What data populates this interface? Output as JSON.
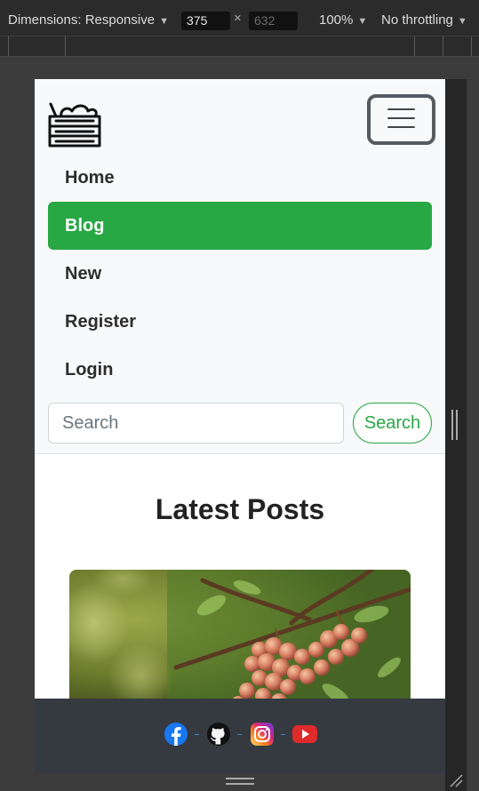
{
  "devtools": {
    "dimensions_label": "Dimensions: Responsive",
    "width": "375",
    "height": "632",
    "zoom": "100%",
    "throttling": "No throttling"
  },
  "navbar": {
    "brand_icon": "vegetable-crate-icon",
    "toggler_icon": "hamburger-icon",
    "items": [
      {
        "label": "Home",
        "active": false
      },
      {
        "label": "Blog",
        "active": true
      },
      {
        "label": "New",
        "active": false
      },
      {
        "label": "Register",
        "active": false
      },
      {
        "label": "Login",
        "active": false
      }
    ],
    "search": {
      "placeholder": "Search",
      "button_label": "Search"
    }
  },
  "main": {
    "section_title": "Latest Posts",
    "post_image": "grapes-on-vine-photo"
  },
  "footer": {
    "social_icons": [
      "facebook-icon",
      "github-icon",
      "instagram-icon",
      "youtube-icon"
    ]
  },
  "colors": {
    "accent_green": "#28a745",
    "navbar_bg": "#f8f9fa",
    "footer_bg": "#343a40",
    "devtools_bg": "#2b2b2b"
  }
}
